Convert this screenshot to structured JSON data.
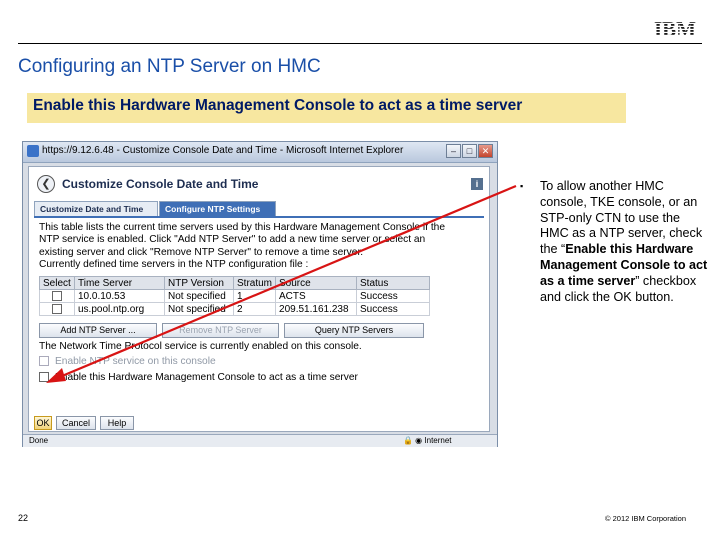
{
  "slide": {
    "logo_text": "IBM",
    "title": "Configuring an NTP Server on HMC",
    "banner": "Enable this Hardware Management Console to act as a time server",
    "page_number": "22",
    "copyright": "© 2012 IBM Corporation"
  },
  "browser": {
    "title": "https://9.12.6.48 - Customize Console Date and Time - Microsoft Internet Explorer",
    "status_left": "Done",
    "status_right": "Internet"
  },
  "dialog": {
    "title": "Customize Console Date and Time",
    "tabs": [
      {
        "label": "Customize Date and Time",
        "active": false
      },
      {
        "label": "Configure NTP Settings",
        "active": true
      }
    ],
    "description_lines": [
      "This table lists the current time servers used by this Hardware Management Console if the",
      "NTP service is enabled. Click \"Add NTP Server\" to add a new time server or select an",
      "existing server and click \"Remove NTP Server\" to remove a time server.",
      "Currently defined time servers in the NTP configuration file :"
    ],
    "table": {
      "headers": [
        "Select",
        "Time Server",
        "NTP Version",
        "Stratum",
        "Source",
        "Status"
      ],
      "rows": [
        {
          "server": "10.0.10.53",
          "version": "Not specified",
          "stratum": "1",
          "source": "ACTS",
          "status": "Success"
        },
        {
          "server": "us.pool.ntp.org",
          "version": "Not specified",
          "stratum": "2",
          "source": "209.51.161.238",
          "status": "Success"
        }
      ]
    },
    "buttons": {
      "add": "Add NTP Server ...",
      "remove": "Remove NTP Server",
      "query": "Query NTP Servers"
    },
    "service_status": "The Network Time Protocol service is currently enabled on this console.",
    "enable_ntp_label": "Enable NTP service on this console",
    "enable_time_server_label": "Enable this Hardware Management Console to act as a time server",
    "ok": "OK",
    "cancel": "Cancel",
    "help": "Help"
  },
  "bullet": {
    "marker": "▪",
    "text_parts": [
      "To allow another HMC console, TKE console, or an STP-only CTN to use the HMC as a NTP server, check the “",
      "Enable this Hardware Management Console to act as a time server",
      "” checkbox and click the OK button."
    ]
  },
  "colors": {
    "title_blue": "#1a4fa8",
    "banner_bg": "#f7e7a0",
    "arrow_red": "#d81414",
    "tab_active": "#3f6fb6"
  }
}
